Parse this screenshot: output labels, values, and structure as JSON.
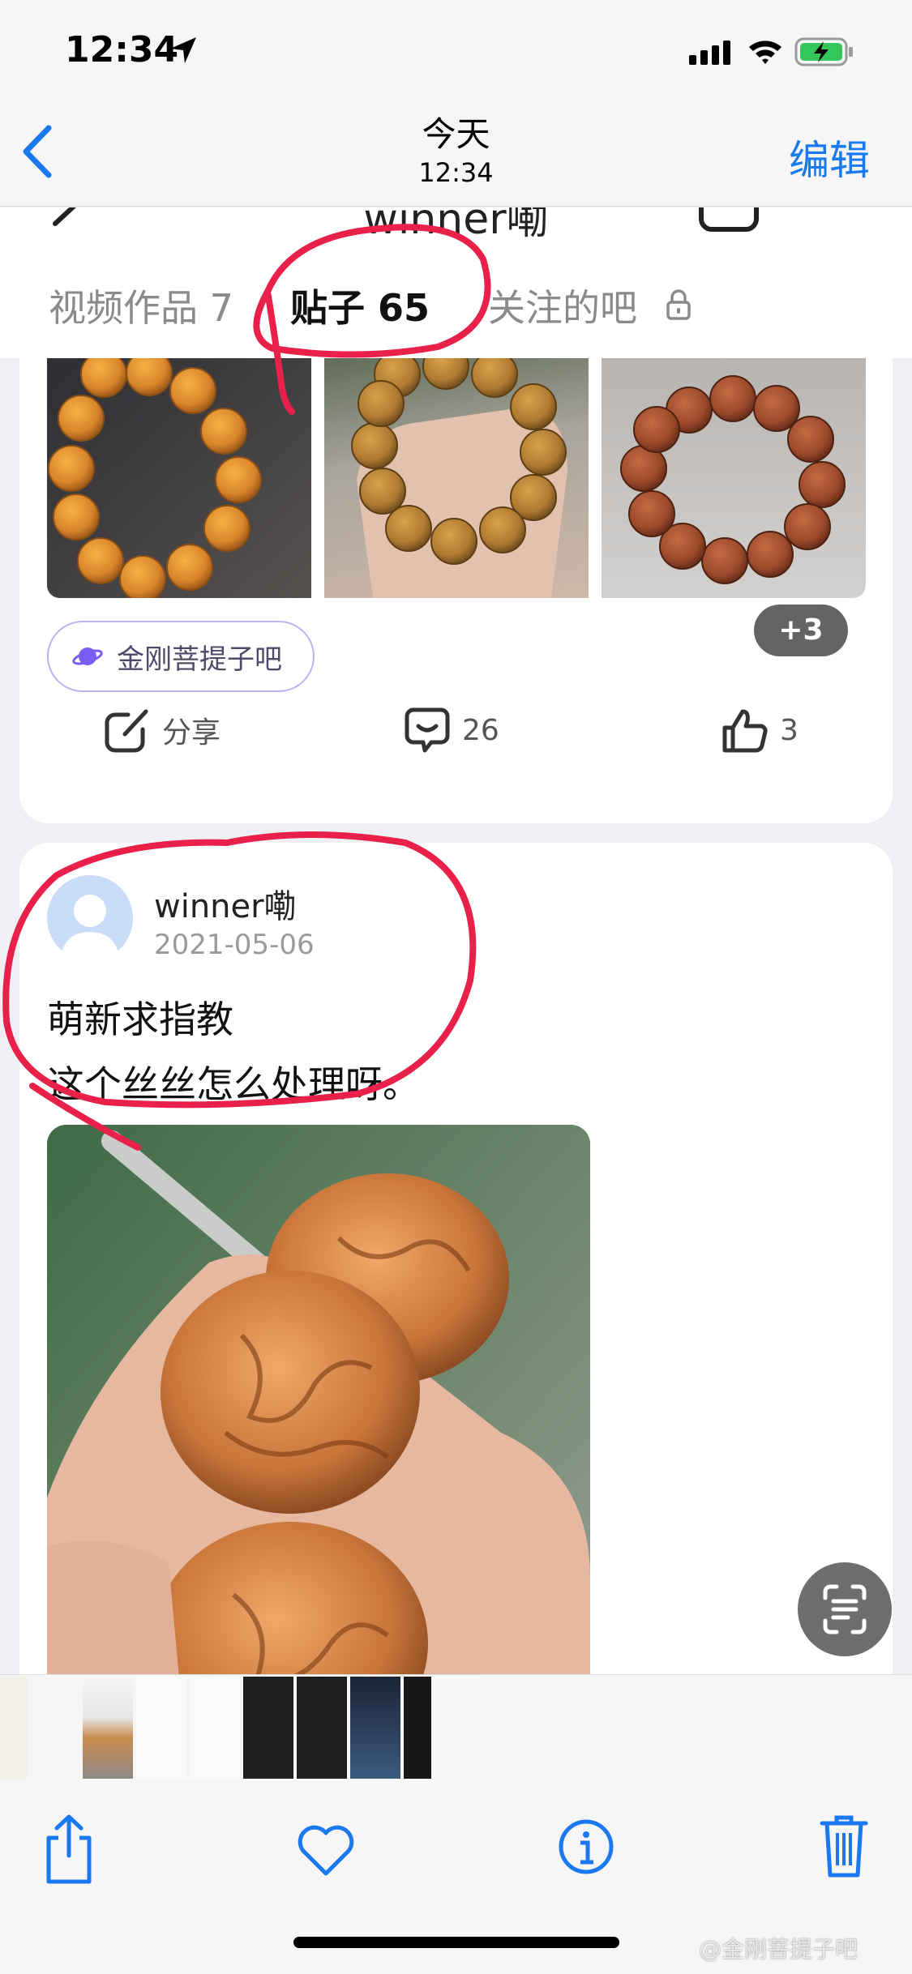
{
  "status_bar": {
    "time": "12:34"
  },
  "photo_nav": {
    "title": "今天",
    "subtitle": "12:34",
    "edit_label": "编辑"
  },
  "profile": {
    "name": "winner嘞",
    "tabs": [
      {
        "label": "视频作品 7"
      },
      {
        "label": "贴子 65"
      },
      {
        "label": "关注的吧"
      }
    ]
  },
  "post_1": {
    "more_images_badge": "+3",
    "forum": "金刚菩提子吧",
    "actions": {
      "share_label": "分享",
      "comment_count": "26",
      "like_count": "3"
    }
  },
  "post_2": {
    "user": "winner嘞",
    "date": "2021-05-06",
    "text_lines": [
      "萌新求指教",
      "这个丝丝怎么处理呀。"
    ]
  },
  "watermark": "@金刚菩提子吧",
  "colors": {
    "accent_blue": "#1a78f0",
    "tab_indicator": "#6b63f0",
    "markup_red": "#e8204a"
  }
}
